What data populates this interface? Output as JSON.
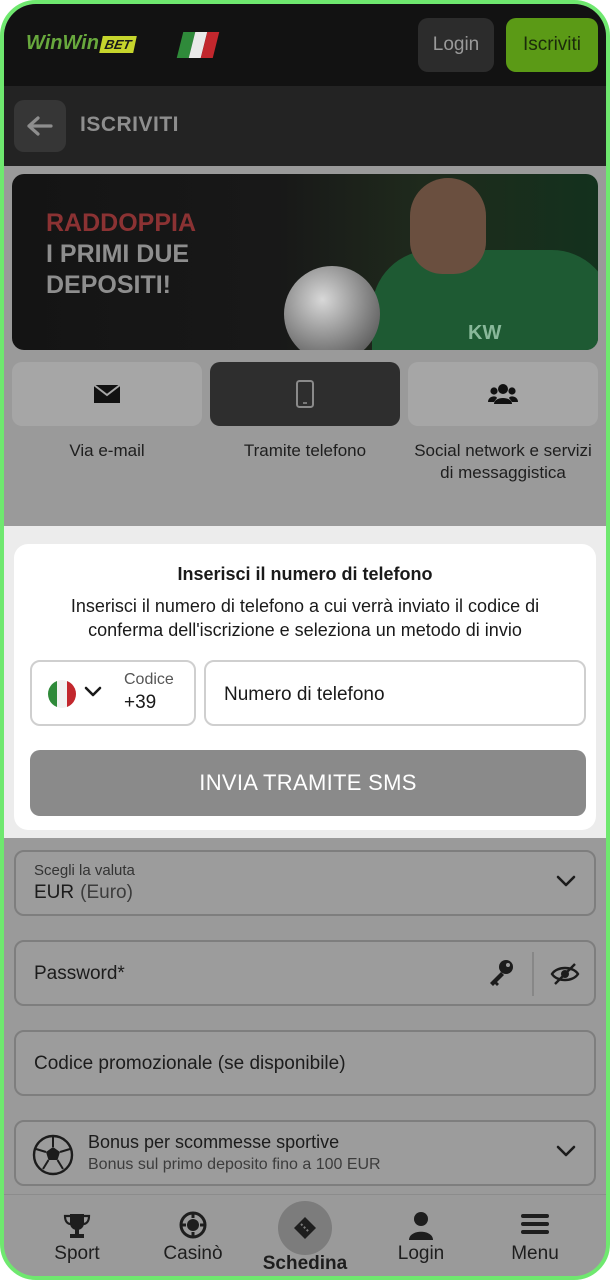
{
  "header": {
    "logo_text": "WinWin",
    "logo_badge": "BET",
    "login_label": "Login",
    "signup_label": "Iscriviti"
  },
  "titlebar": {
    "title": "ISCRIVITI"
  },
  "banner": {
    "line1": "RADDOPPIA",
    "line2": "I PRIMI DUE",
    "line3": "DEPOSITI!",
    "shirt_text": "KW"
  },
  "methods": [
    {
      "label": "Via e-mail",
      "icon": "envelope-icon",
      "active": false
    },
    {
      "label": "Tramite telefono",
      "icon": "phone-icon",
      "active": true
    },
    {
      "label": "Social network e servizi di messaggistica",
      "icon": "users-icon",
      "active": false
    }
  ],
  "modal": {
    "title": "Inserisci il numero di telefono",
    "description": "Inserisci il numero di telefono a cui verrà inviato il codice di conferma dell'iscrizione e seleziona un metodo di invio",
    "country_code_label": "Codice",
    "country_code_value": "+39",
    "phone_placeholder": "Numero di telefono",
    "submit_label": "INVIA TRAMITE SMS"
  },
  "form": {
    "currency_label": "Scegli la valuta",
    "currency_value": "EUR",
    "currency_name": "(Euro)",
    "password_placeholder": "Password*",
    "promo_placeholder": "Codice promozionale (se disponibile)",
    "bonus_title": "Bonus per scommesse sportive",
    "bonus_subtitle": "Bonus sul primo deposito fino a 100 EUR"
  },
  "bottom_nav": {
    "sport": "Sport",
    "casino": "Casinò",
    "betslip": "Schedina",
    "login": "Login",
    "menu": "Menu"
  },
  "colors": {
    "accent_green": "#5b9a16",
    "frame_green": "#6fe86f",
    "header_bg": "#121212"
  }
}
